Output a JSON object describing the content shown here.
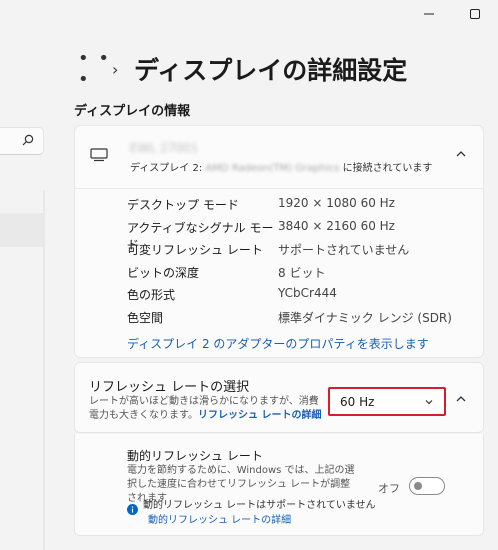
{
  "window": {
    "minimize_icon": "minimize-icon",
    "maximize_icon": "maximize-icon"
  },
  "breadcrumb": {
    "more": "• • •",
    "separator": "›",
    "title": "ディスプレイの詳細設定"
  },
  "section": {
    "label": "ディスプレイの情報"
  },
  "display": {
    "name": "EWL 27001",
    "connection_prefix": "ディスプレイ 2: ",
    "adapter_name": "AMD Radeon(TM) Graphics",
    "connection_suffix": " に接続されています",
    "properties": [
      {
        "key": "デスクトップ モード",
        "value": "1920 × 1080 60 Hz"
      },
      {
        "key": "アクティブなシグナル モード",
        "value": "3840 × 2160 60 Hz"
      },
      {
        "key": "可変リフレッシュ レート",
        "value": "サポートされていません"
      },
      {
        "key": "ビットの深度",
        "value": "8 ビット"
      },
      {
        "key": "色の形式",
        "value": "YCbCr444"
      },
      {
        "key": "色空間",
        "value": "標準ダイナミック レンジ (SDR)"
      }
    ],
    "adapter_link": "ディスプレイ 2 のアダプターのプロパティを表示します"
  },
  "refresh": {
    "title": "リフレッシュ レートの選択",
    "desc": "レートが高いほど動きは滑らかになりますが、消費電力も大きくなります。",
    "link": "リフレッシュ レートの詳細",
    "selected": "60 Hz"
  },
  "dynamic": {
    "title": "動的リフレッシュ レート",
    "desc": "電力を節約するために、Windows では、上記の選択した速度に合わせてリフレッシュ レートが調整されます",
    "toggle_label": "オフ",
    "toggle_on": false,
    "info": "動的リフレッシュ レートはサポートされていません",
    "info_link": "動的リフレッシュ レートの詳細"
  },
  "colors": {
    "accent_link": "#1a5fb4",
    "highlight_border": "#d21f2b",
    "info_blue": "#0067c0"
  }
}
